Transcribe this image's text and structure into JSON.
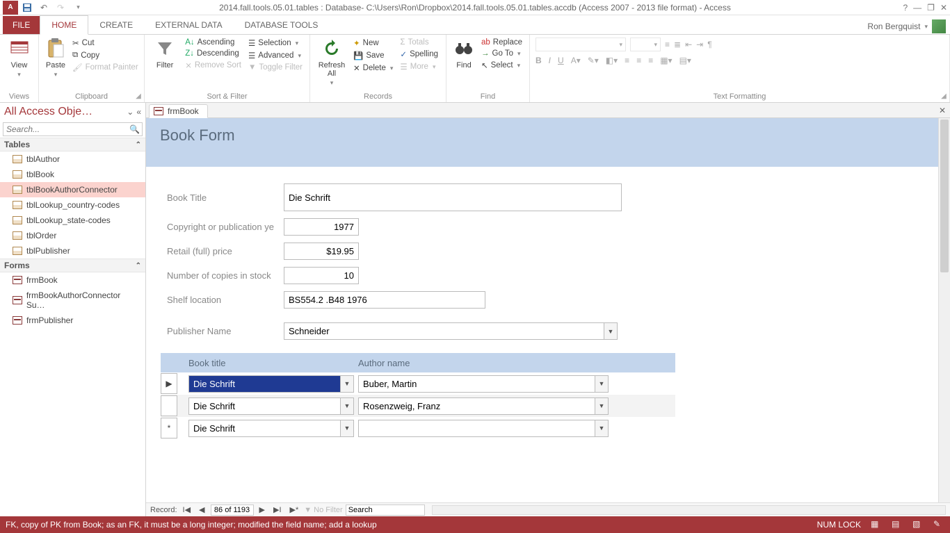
{
  "titlebar": {
    "title": "2014.fall.tools.05.01.tables : Database- C:\\Users\\Ron\\Dropbox\\2014.fall.tools.05.01.tables.accdb (Access 2007 - 2013 file format) - Access",
    "user": "Ron Bergquist"
  },
  "tabs": {
    "file": "FILE",
    "home": "HOME",
    "create": "CREATE",
    "external": "EXTERNAL DATA",
    "dbtools": "DATABASE TOOLS"
  },
  "ribbon": {
    "views": {
      "view": "View",
      "label": "Views"
    },
    "clipboard": {
      "paste": "Paste",
      "cut": "Cut",
      "copy": "Copy",
      "fmt": "Format Painter",
      "label": "Clipboard"
    },
    "sortfilter": {
      "filter": "Filter",
      "asc": "Ascending",
      "desc": "Descending",
      "remove": "Remove Sort",
      "selection": "Selection",
      "advanced": "Advanced",
      "toggle": "Toggle Filter",
      "label": "Sort & Filter"
    },
    "records": {
      "refresh": "Refresh All",
      "new": "New",
      "save": "Save",
      "delete": "Delete",
      "totals": "Totals",
      "spelling": "Spelling",
      "more": "More",
      "label": "Records"
    },
    "find": {
      "find": "Find",
      "replace": "Replace",
      "goto": "Go To",
      "select": "Select",
      "label": "Find"
    },
    "textfmt": {
      "label": "Text Formatting"
    }
  },
  "nav": {
    "header": "All Access Obje…",
    "search_ph": "Search...",
    "groups": {
      "tables": "Tables",
      "forms": "Forms"
    },
    "tables": [
      "tblAuthor",
      "tblBook",
      "tblBookAuthorConnector",
      "tblLookup_country-codes",
      "tblLookup_state-codes",
      "tblOrder",
      "tblPublisher"
    ],
    "forms": [
      "frmBook",
      "frmBookAuthorConnector Su…",
      "frmPublisher"
    ]
  },
  "doc": {
    "tab": "frmBook",
    "formTitle": "Book Form",
    "fields": {
      "bookTitle": {
        "label": "Book Title",
        "value": "Die Schrift"
      },
      "year": {
        "label": "Copyright or publication ye",
        "value": "1977"
      },
      "price": {
        "label": "Retail (full) price",
        "value": "$19.95"
      },
      "stock": {
        "label": "Number of copies in stock",
        "value": "10"
      },
      "shelf": {
        "label": "Shelf location",
        "value": "BS554.2 .B48 1976"
      },
      "publisher": {
        "label": "Publisher Name",
        "value": "Schneider"
      }
    },
    "subform": {
      "headers": {
        "title": "Book title",
        "author": "Author name"
      },
      "rows": [
        {
          "title": "Die Schrift",
          "author": "Buber, Martin",
          "current": true
        },
        {
          "title": "Die Schrift",
          "author": "Rosenzweig, Franz",
          "current": false
        },
        {
          "title": "Die Schrift",
          "author": "",
          "current": false,
          "new": true
        }
      ]
    },
    "recnav": {
      "label": "Record:",
      "pos": "86 of 1193",
      "nofilter": "No Filter",
      "search": "Search"
    }
  },
  "statusbar": {
    "msg": "FK, copy of PK from Book; as an FK, it must be a long integer; modified the field name; add a lookup",
    "numlock": "NUM LOCK"
  }
}
